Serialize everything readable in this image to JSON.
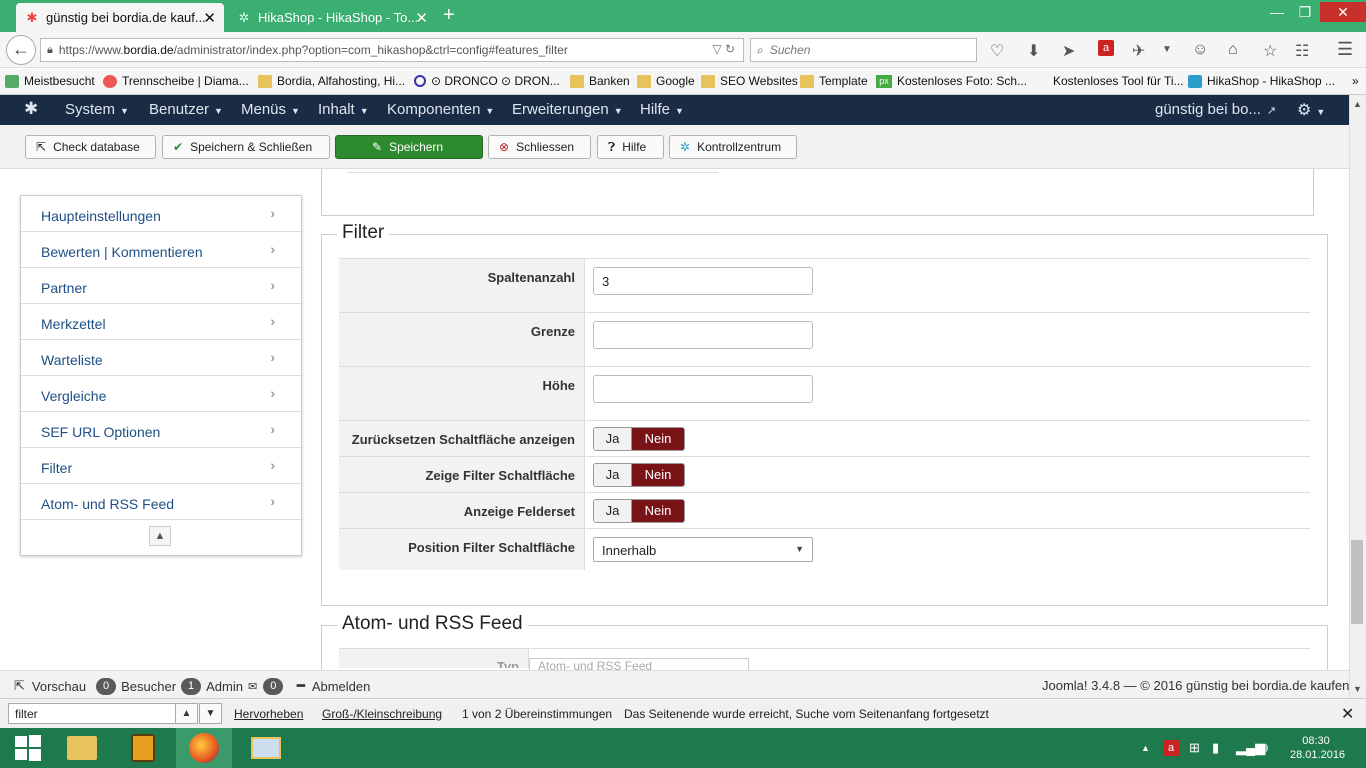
{
  "browser": {
    "tabs": [
      {
        "title": "günstig bei bordia.de kauf...",
        "icon": "joomla-icon",
        "active": true
      },
      {
        "title": "HikaShop - HikaShop - To...",
        "icon": "hikashop-icon",
        "active": false
      }
    ],
    "url_prefix": "https://www.",
    "url_domain": "bordia.de",
    "url_path": "/administrator/index.php?option=com_hikashop&ctrl=config#features_filter",
    "search_placeholder": "Suchen",
    "bookmarks": [
      {
        "label": "Meistbesucht",
        "icon": "gear-icon"
      },
      {
        "label": "Trennscheibe | Diama...",
        "icon": "flame-icon"
      },
      {
        "label": "Bordia, Alfahosting, Hi...",
        "icon": "folder-icon"
      },
      {
        "label": "⊙ DRONCO ⊙ DRON...",
        "icon": "dronco-icon"
      },
      {
        "label": "Banken",
        "icon": "folder-icon"
      },
      {
        "label": "Google",
        "icon": "folder-icon"
      },
      {
        "label": "SEO Websites",
        "icon": "folder-icon"
      },
      {
        "label": "Template",
        "icon": "folder-icon"
      },
      {
        "label": "Kostenloses Foto: Sch...",
        "icon": "px-icon"
      },
      {
        "label": "Kostenloses Tool für Ti...",
        "icon": "page-icon"
      },
      {
        "label": "HikaShop - HikaShop ...",
        "icon": "hikashop-icon"
      }
    ]
  },
  "joomla": {
    "menu": [
      "System",
      "Benutzer",
      "Menüs",
      "Inhalt",
      "Komponenten",
      "Erweiterungen",
      "Hilfe"
    ],
    "site_link": "günstig bei bo...",
    "toolbar": {
      "check_db": "Check database",
      "save_close": "Speichern & Schließen",
      "save": "Speichern",
      "close": "Schliessen",
      "help": "Hilfe",
      "control": "Kontrollzentrum"
    },
    "sidebar": [
      "Haupteinstellungen",
      "Bewerten | Kommentieren",
      "Partner",
      "Merkzettel",
      "Warteliste",
      "Vergleiche",
      "SEF URL Optionen",
      "Filter",
      "Atom- und RSS Feed"
    ],
    "filter": {
      "legend": "Filter",
      "columns_label": "Spaltenanzahl",
      "columns_value": "3",
      "limit_label": "Grenze",
      "limit_value": "",
      "height_label": "Höhe",
      "height_value": "",
      "reset_label": "Zurücksetzen Schaltfläche anzeigen",
      "show_btn_label": "Zeige Filter Schaltfläche",
      "fieldset_label": "Anzeige Felderset",
      "yes": "Ja",
      "no": "Nein",
      "position_label": "Position Filter Schaltfläche",
      "position_value": "Innerhalb"
    },
    "rss": {
      "legend": "Atom- und RSS Feed",
      "type_label": "Typ",
      "type_value": "Atom- und RSS Feed"
    },
    "status": {
      "preview": "Vorschau",
      "visitors_count": "0",
      "visitors": "Besucher",
      "admin_count": "1",
      "admin": "Admin",
      "messages_count": "0",
      "logout": "Abmelden",
      "version": "Joomla! 3.4.8",
      "sep": "—",
      "copyright": "© 2016 günstig bei bordia.de kaufen"
    }
  },
  "findbar": {
    "query": "filter",
    "highlight": "Hervorheben",
    "match_case": "Groß-/Kleinschreibung",
    "result": "1 von 2 Übereinstimmungen",
    "message": "Das Seitenende wurde erreicht, Suche vom Seitenanfang fortgesetzt"
  },
  "taskbar": {
    "time": "08:30",
    "date": "28.01.2016"
  },
  "colors": {
    "tabbar": "#3bae72",
    "joomla_nav": "#1a2b45",
    "save_green": "#2e8a2e",
    "nein_red": "#7a1317",
    "taskbar": "#1e7a4d"
  }
}
